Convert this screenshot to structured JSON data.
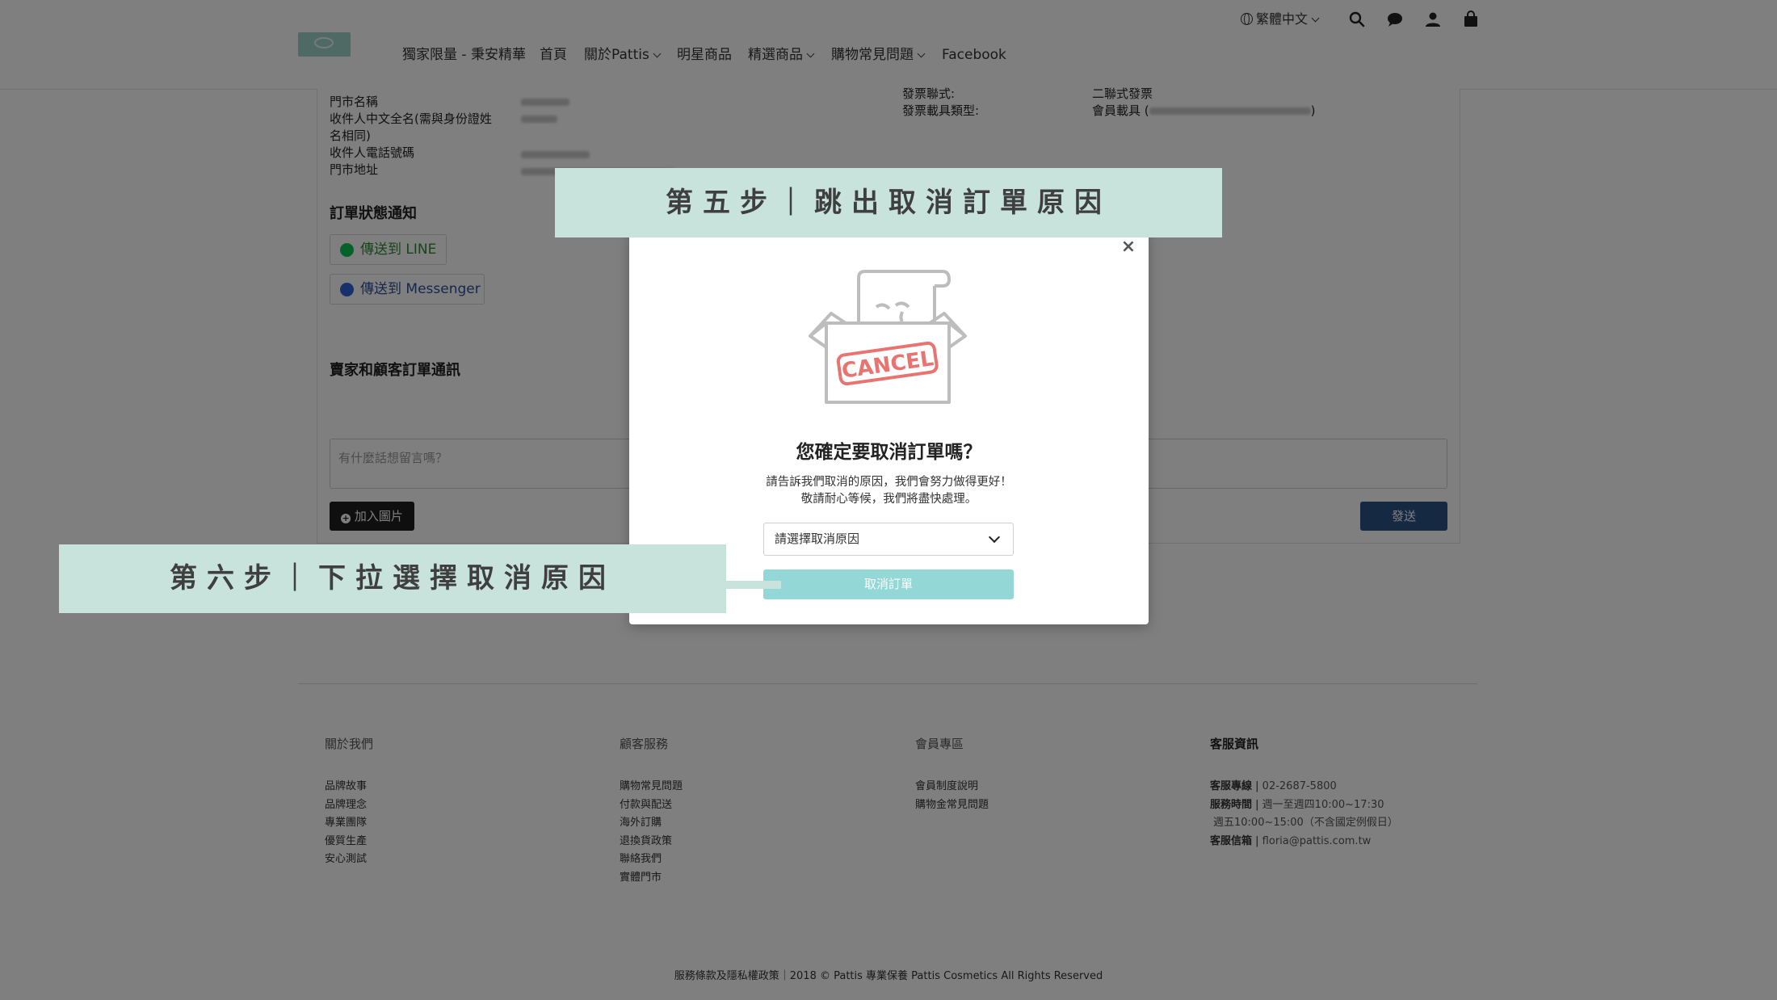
{
  "header": {
    "nav": [
      {
        "label": "獨家限量 - 秉安精華",
        "dropdown": false
      },
      {
        "label": "首頁",
        "dropdown": false
      },
      {
        "label": "關於Pattis",
        "dropdown": true
      },
      {
        "label": "明星商品",
        "dropdown": false
      },
      {
        "label": "精選商品",
        "dropdown": true
      },
      {
        "label": "購物常見問題",
        "dropdown": true
      },
      {
        "label": "Facebook",
        "dropdown": false
      }
    ],
    "language": "繁體中文",
    "icons": [
      "globe-icon",
      "search-icon",
      "chat-icon",
      "user-icon",
      "cart-icon"
    ]
  },
  "order_info": {
    "labels": [
      "門市名稱",
      "收件人中文全名(需與身份證姓",
      "名相同)",
      "收件人電話號碼",
      "門市地址"
    ],
    "invoice_labels": [
      "發票聯式:",
      "發票載具類型:"
    ],
    "invoice_values": [
      "二聯式發票",
      "會員載具 (",
      ")"
    ]
  },
  "notification": {
    "title": "訂單狀態通知",
    "line_button": "傳送到 LINE",
    "messenger_button": "傳送到 Messenger"
  },
  "messages": {
    "title": "賣家和顧客訂單通訊",
    "placeholder": "有什麼話想留言嗎？",
    "add_image": "加入圖片",
    "send": "發送"
  },
  "modal": {
    "close": "×",
    "illustration_text": "CANCEL",
    "title": "您確定要取消訂單嗎？",
    "desc_line1": "請告訴我們取消的原因，我們會努力做得更好！",
    "desc_line2": "敬請耐心等候，我們將盡快處理。",
    "select_placeholder": "請選擇取消原因",
    "cancel_button": "取消訂單"
  },
  "banners": {
    "step5": "第五步｜跳出取消訂單原因",
    "step6": "第六步｜下拉選擇取消原因",
    "color": "#c7e3dc"
  },
  "footer": {
    "columns": [
      {
        "title": "關於我們",
        "links": [
          "品牌故事",
          "品牌理念",
          "專業團隊",
          "優質生產",
          "安心測試"
        ]
      },
      {
        "title": "顧客服務",
        "links": [
          "購物常見問題",
          "付款與配送",
          "海外訂購",
          "退換貨政策",
          "聯絡我們",
          "實體門市"
        ]
      },
      {
        "title": "會員專區",
        "links": [
          "會員制度說明",
          "購物金常見問題"
        ]
      }
    ],
    "service": {
      "title": "客服資訊",
      "hotline_label": "客服專線",
      "hotline": "02-2687-5800",
      "hours_label": "服務時間",
      "hours1": "週一至週四10:00~17:30",
      "hours2": "週五10:00~15:00（不含國定例假日）",
      "email_label": "客服信箱",
      "email": "floria@pattis.com.tw"
    },
    "copyright": "服務條款及隱私權政策｜2018 © Pattis 專業保養 Pattis Cosmetics All Rights Reserved"
  },
  "colors": {
    "accent": "#93d8d6",
    "send_button": "#2d5385",
    "line_green": "#06c755",
    "messenger_blue": "#2d63d8",
    "cancel_stamp": "#e8736f"
  }
}
